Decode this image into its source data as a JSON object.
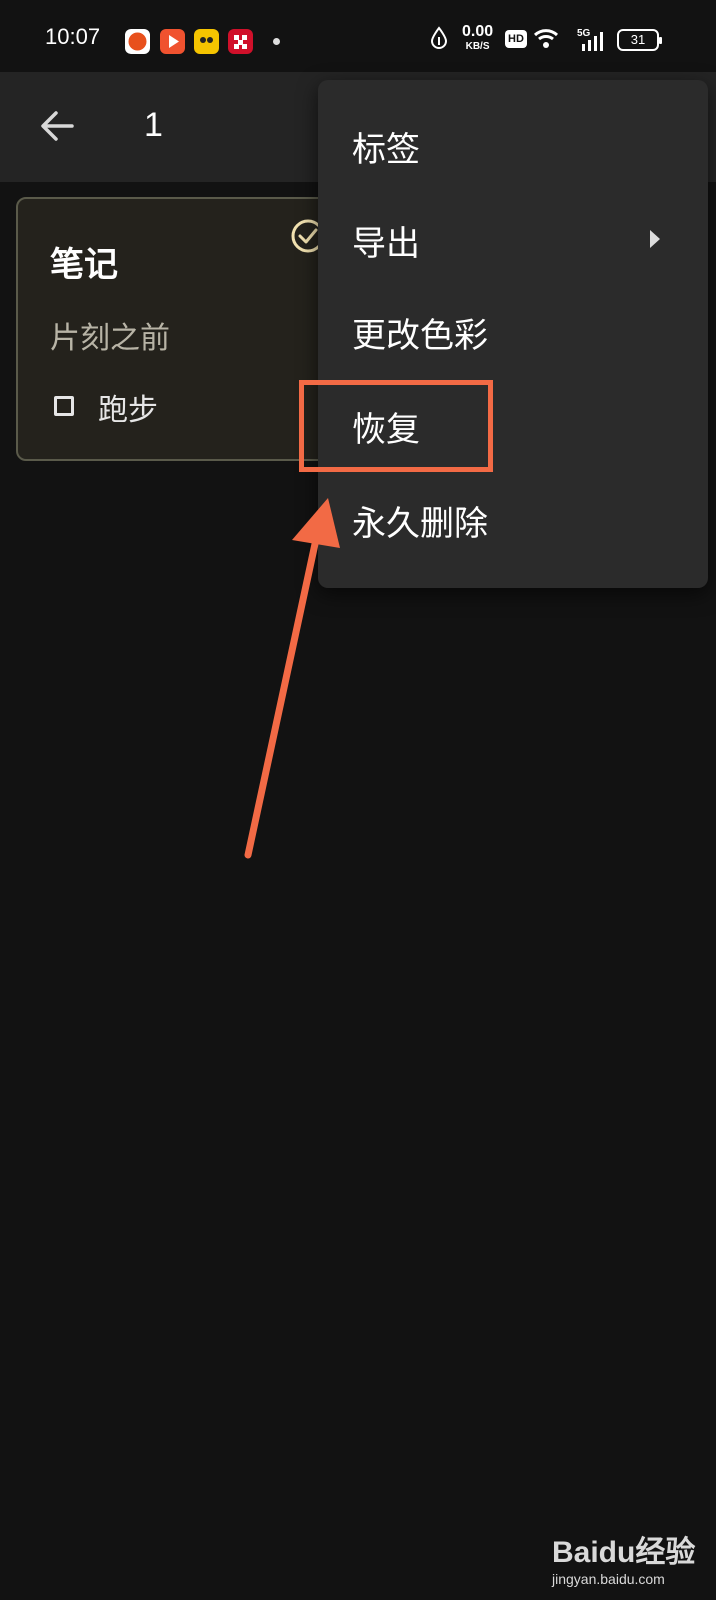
{
  "status_bar": {
    "time": "10:07",
    "net_speed": "0.00",
    "net_speed_unit": "KB/S",
    "hd_badge": "HD",
    "network_type": "5G",
    "battery": "31"
  },
  "toolbar": {
    "selected_count": "1"
  },
  "note": {
    "title": "笔记",
    "time": "片刻之前",
    "checklist_item": "跑步",
    "accent_color": "#f2e2b0"
  },
  "menu": {
    "items": [
      {
        "label": "标签"
      },
      {
        "label": "导出"
      },
      {
        "label": "更改色彩"
      },
      {
        "label": "恢复"
      },
      {
        "label": "永久删除"
      }
    ]
  },
  "annotation": {
    "color": "#f26a45"
  },
  "watermark": {
    "brand": "Baidu经验",
    "site": "jingyan.baidu.com"
  }
}
